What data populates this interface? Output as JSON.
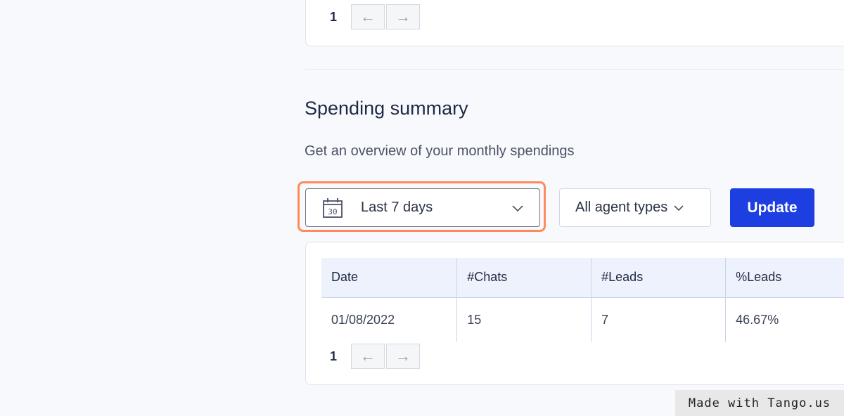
{
  "top_pager": {
    "page": "1",
    "prev_icon": "arrow-left-icon",
    "next_icon": "arrow-right-icon"
  },
  "spending": {
    "title": "Spending summary",
    "description": "Get an overview of your monthly spendings",
    "date_filter": {
      "value": "Last 7 days",
      "icon": "calendar-icon"
    },
    "agent_filter": {
      "value": "All agent types"
    },
    "update_label": "Update",
    "table": {
      "headers": [
        "Date",
        "#Chats",
        "#Leads",
        "%Leads"
      ],
      "rows": [
        [
          "01/08/2022",
          "15",
          "7",
          "46.67%"
        ]
      ]
    },
    "pager": {
      "page": "1"
    }
  },
  "watermark": "Made with Tango.us",
  "colors": {
    "accent": "#1d3ee0",
    "highlight": "#ff8a5b",
    "header_bg": "#eef2fc"
  }
}
